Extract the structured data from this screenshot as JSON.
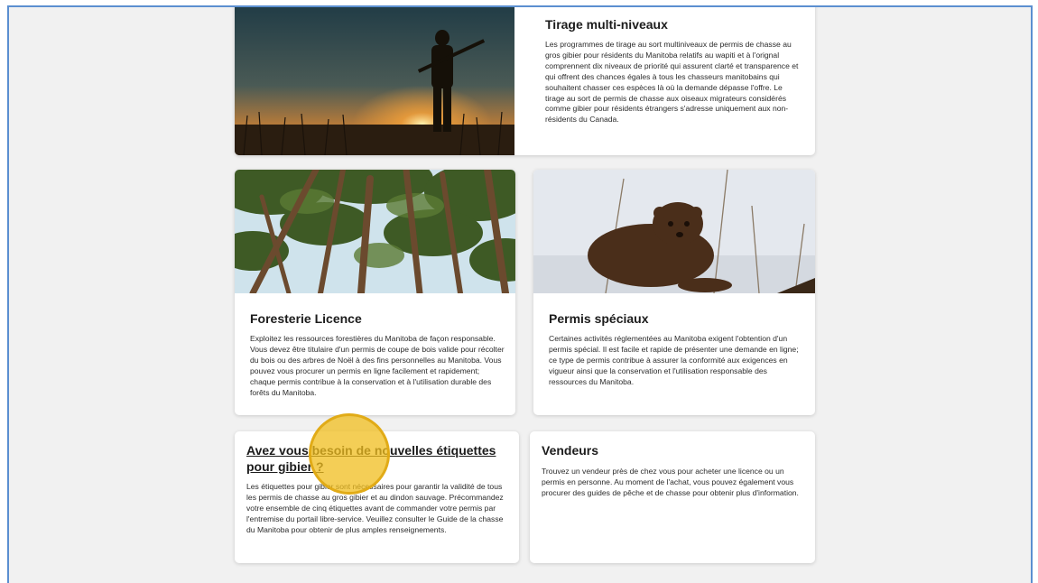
{
  "cards": {
    "tirage": {
      "title": "Tirage multi-niveaux",
      "body": "Les programmes de tirage au sort multiniveaux de permis de chasse au gros gibier pour résidents du Manitoba relatifs au wapiti et à l'orignal comprennent dix niveaux de priorité qui assurent clarté et transparence et qui offrent des chances égales à tous les chasseurs manitobains qui souhaitent chasser ces espèces là où la demande dépasse l'offre. Le tirage au sort de permis de chasse aux oiseaux migrateurs considérés comme gibier pour résidents étrangers s'adresse uniquement aux non-résidents du Canada.",
      "image": "hunter-at-sunset-photo"
    },
    "foresterie": {
      "title": "Foresterie Licence",
      "body": "Exploitez les ressources forestières du Manitoba de façon responsable. Vous devez être titulaire d'un permis de coupe de bois valide pour récolter du bois ou des arbres de Noël à des fins personnelles au Manitoba. Vous pouvez vous procurer un permis en ligne facilement et rapidement; chaque permis contribue à la conservation et à l'utilisation durable des forêts du Manitoba.",
      "image": "pine-forest-photo"
    },
    "permis": {
      "title": "Permis spéciaux",
      "body": "Certaines activités réglementées au Manitoba exigent l'obtention d'un permis spécial. Il est facile et rapide de présenter une demande en ligne; ce type de permis contribue à assurer la conformité aux exigences en vigueur ainsi que la conservation et l'utilisation responsable des ressources du Manitoba.",
      "image": "fisher-in-snow-photo"
    },
    "etiquettes": {
      "title": "Avez vous besoin de nouvelles étiquettes pour gibier ?",
      "body": "Les étiquettes pour gibier sont nécessaires pour garantir la validité de tous les permis de chasse au gros gibier et au dindon sauvage. Précommandez votre ensemble de cinq étiquettes avant de commander votre permis par l'entremise du portail libre-service. Veuillez consulter le Guide de la chasse du Manitoba pour obtenir de plus amples renseignements."
    },
    "vendeurs": {
      "title": "Vendeurs",
      "body": "Trouvez un vendeur près de chez vous pour acheter une licence ou un permis en personne. Au moment de l'achat, vous pouvez également vous procurer des guides de pêche et de chasse pour obtenir plus d'information."
    }
  },
  "colors": {
    "background": "#f1f1f1",
    "card": "#ffffff",
    "frame_border": "#5b8fd0",
    "cursor_highlight": "#f0be1e"
  }
}
